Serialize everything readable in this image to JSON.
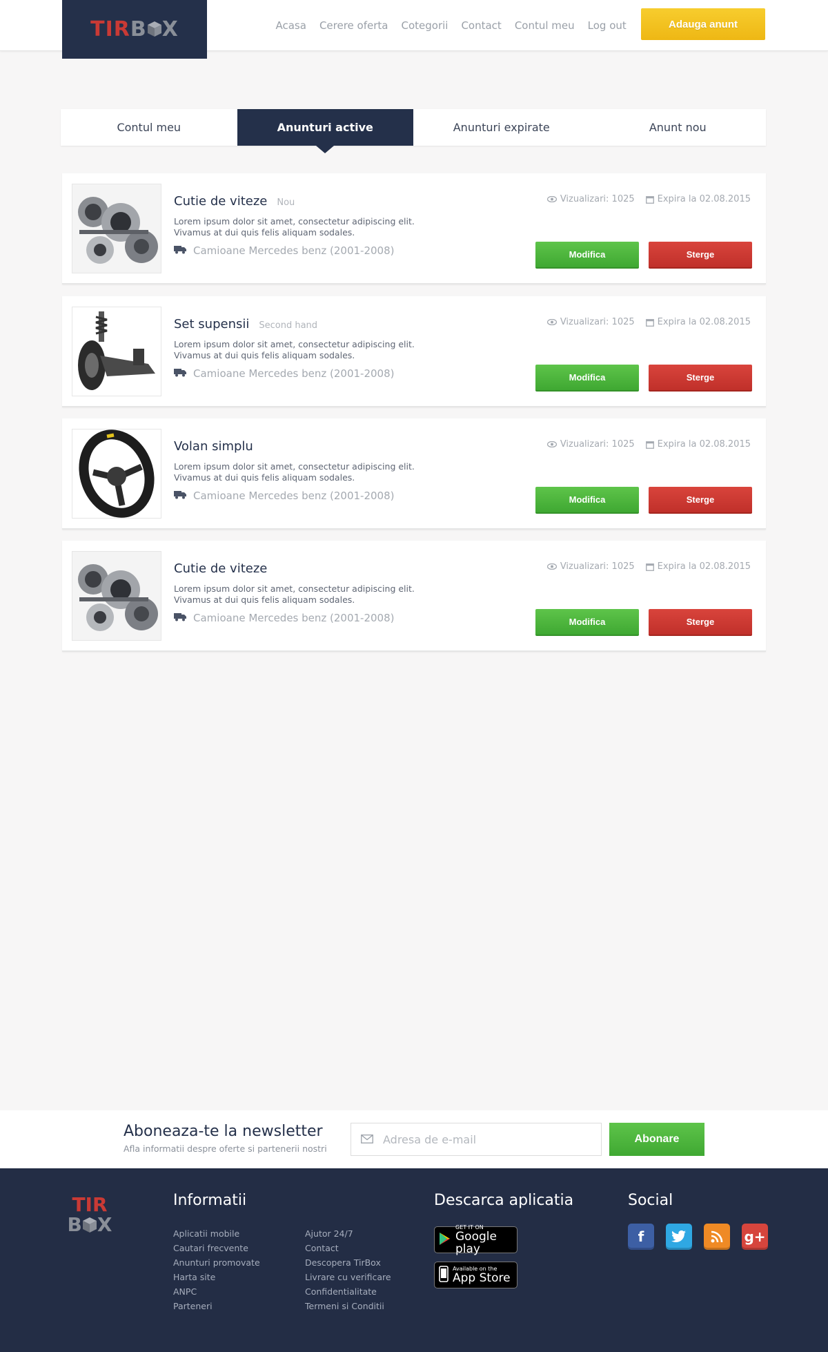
{
  "brand": {
    "logo_part1": "TIR",
    "logo_part2": "B",
    "logo_part3": "X"
  },
  "header": {
    "nav": [
      "Acasa",
      "Cerere oferta",
      "Cotegorii",
      "Contact",
      "Contul meu",
      "Log out"
    ],
    "add_button": "Adauga anunt"
  },
  "tabs": [
    {
      "label": "Contul meu",
      "active": false
    },
    {
      "label": "Anunturi active",
      "active": true
    },
    {
      "label": "Anunturi expirate",
      "active": false
    },
    {
      "label": "Anunt nou",
      "active": false
    }
  ],
  "listings": [
    {
      "title": "Cutie de viteze",
      "badge": "Nou",
      "image": "gearbox-image",
      "desc1": "Lorem ipsum dolor sit amet, consectetur adipiscing elit.",
      "desc2": "Vivamus at dui quis felis aliquam sodales.",
      "category": "Camioane Mercedes benz (2001-2008)",
      "views": "Vizualizari: 1025",
      "expires": "Expira la 02.08.2015",
      "edit": "Modifica",
      "delete": "Sterge"
    },
    {
      "title": "Set supensii",
      "badge": "Second hand",
      "image": "suspension-image",
      "desc1": "Lorem ipsum dolor sit amet, consectetur adipiscing elit.",
      "desc2": "Vivamus at dui quis felis aliquam sodales.",
      "category": "Camioane Mercedes benz (2001-2008)",
      "views": "Vizualizari: 1025",
      "expires": "Expira la 02.08.2015",
      "edit": "Modifica",
      "delete": "Sterge"
    },
    {
      "title": "Volan simplu",
      "badge": "",
      "image": "steering-wheel-image",
      "desc1": "Lorem ipsum dolor sit amet, consectetur adipiscing elit.",
      "desc2": "Vivamus at dui quis felis aliquam sodales.",
      "category": "Camioane Mercedes benz (2001-2008)",
      "views": "Vizualizari: 1025",
      "expires": "Expira la 02.08.2015",
      "edit": "Modifica",
      "delete": "Sterge"
    },
    {
      "title": "Cutie de viteze",
      "badge": "",
      "image": "gearbox-image",
      "desc1": "Lorem ipsum dolor sit amet, consectetur adipiscing elit.",
      "desc2": "Vivamus at dui quis felis aliquam sodales.",
      "category": "Camioane Mercedes benz (2001-2008)",
      "views": "Vizualizari: 1025",
      "expires": "Expira la 02.08.2015",
      "edit": "Modifica",
      "delete": "Sterge"
    }
  ],
  "newsletter": {
    "title": "Aboneaza-te la newsletter",
    "subtitle": "Afla informatii despre oferte si partenerii nostri",
    "placeholder": "Adresa de e-mail",
    "button": "Abonare"
  },
  "footer": {
    "info_title": "Informatii",
    "col1": [
      "Aplicatii mobile",
      "Cautari frecvente",
      "Anunturi promovate",
      "Harta site",
      "ANPC",
      "Parteneri"
    ],
    "col2": [
      "Ajutor 24/7",
      "Contact",
      "Descopera TirBox",
      "Livrare cu verificare",
      "Confidentialitate",
      "Termeni si Conditii"
    ],
    "app_title": "Descarca aplicatia",
    "google_small": "GET IT ON",
    "google_big": "Google play",
    "apple_small": "Available on the",
    "apple_big": "App Store",
    "social_title": "Social",
    "social": [
      "facebook-icon",
      "twitter-icon",
      "rss-icon",
      "google-plus-icon"
    ]
  },
  "colors": {
    "navy": "#24304a",
    "accent_yellow": "#f3c11c",
    "green": "#4cb63c",
    "red": "#cc3a33",
    "brand_red": "#c93a35"
  }
}
